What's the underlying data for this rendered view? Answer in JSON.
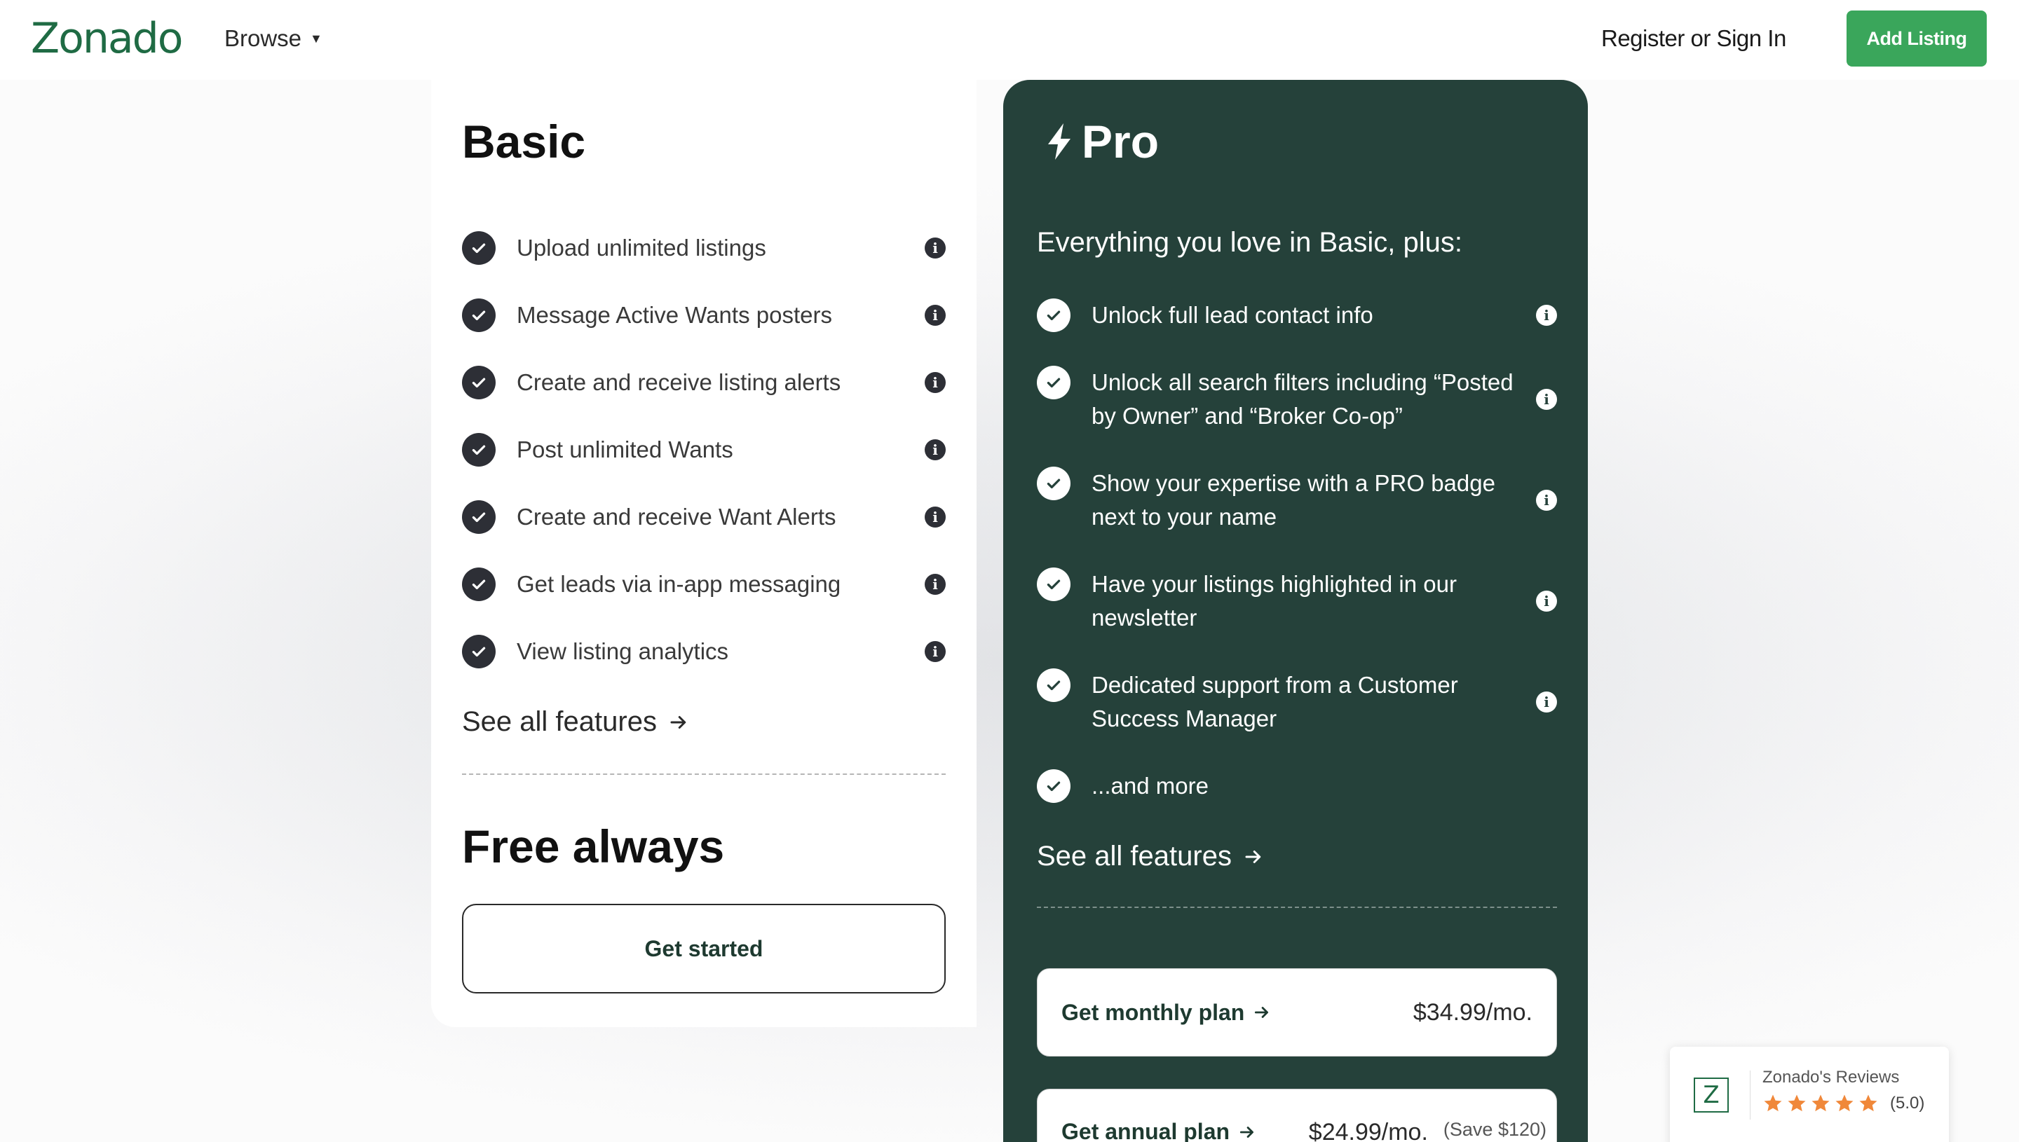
{
  "header": {
    "logo": "Zonado",
    "browse_label": "Browse",
    "signin_label": "Register or Sign In",
    "add_listing_label": "Add Listing"
  },
  "basic": {
    "title": "Basic",
    "features": [
      "Upload unlimited listings",
      "Message Active Wants posters",
      "Create and receive listing alerts",
      "Post unlimited Wants",
      "Create and receive Want Alerts",
      "Get leads via in-app messaging",
      "View listing analytics"
    ],
    "see_all": "See all features",
    "price_title": "Free always",
    "cta": "Get started"
  },
  "pro": {
    "title": "Pro",
    "subtitle": "Everything you love in Basic, plus:",
    "features": [
      "Unlock full lead contact info",
      "Unlock all search filters including “Posted by Owner” and “Broker Co-op”",
      "Show your expertise with a PRO badge next to your name",
      "Have your listings highlighted in our newsletter",
      "Dedicated support from a Customer Success Manager",
      "...and more"
    ],
    "see_all": "See all features",
    "monthly": {
      "label": "Get monthly plan",
      "price": "$34.99/mo."
    },
    "annual": {
      "label": "Get annual plan",
      "price": "$24.99/mo.",
      "save": "(Save $120)"
    }
  },
  "reviews": {
    "logo_letter": "Z",
    "title": "Zonado's Reviews",
    "rating": 5,
    "score": "(5.0)"
  },
  "colors": {
    "brand_green": "#1f6b44",
    "button_green": "#3aa65b",
    "pro_bg": "#25413a",
    "star": "#f0883a"
  },
  "icons": [
    "check-icon",
    "info-icon",
    "bolt-icon",
    "arrow-right-icon",
    "caret-down-icon",
    "star-icon"
  ]
}
